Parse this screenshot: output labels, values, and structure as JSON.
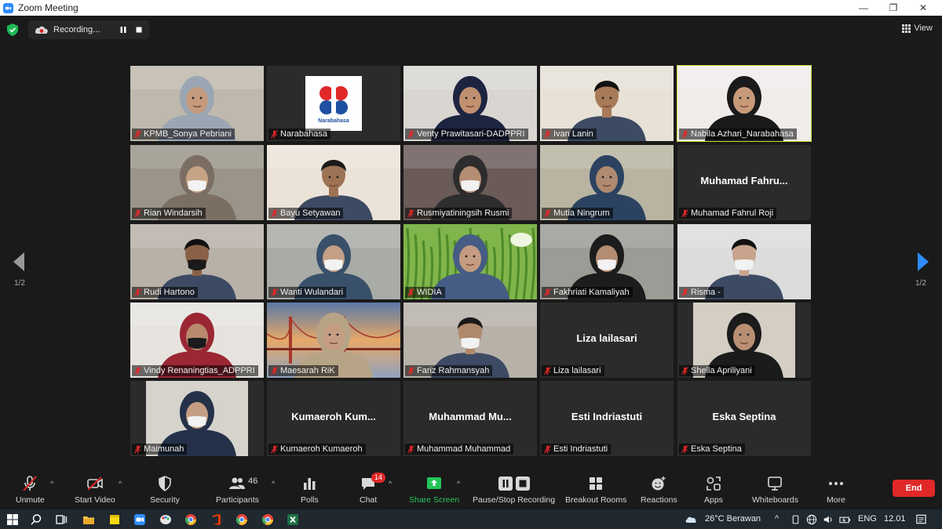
{
  "window": {
    "title": "Zoom Meeting",
    "minimize_icon": "minimize-icon",
    "restore_icon": "restore-icon",
    "close_icon": "close-icon"
  },
  "topbar": {
    "recording_label": "Recording...",
    "view_label": "View"
  },
  "participants": [
    {
      "name": "KPMB_Sonya Pebriani",
      "video": true,
      "bg": "#bfb8ac",
      "skin": "#c59a7c",
      "hijab": "#9aa6b3"
    },
    {
      "name": "Narabahasa",
      "video": false,
      "logo": "Narabahasa"
    },
    {
      "name": "Venty Prawitasari-DADPPRI",
      "video": true,
      "bg": "#d9d6d2",
      "skin": "#c09070",
      "hijab": "#1d2440"
    },
    {
      "name": "Ivan Lanin",
      "video": true,
      "bg": "#e7e1d6",
      "skin": "#a87a58",
      "hair": "#111"
    },
    {
      "name": "Nabila Azhari_Narabahasa",
      "video": true,
      "bg": "#efecea",
      "skin": "#c89a7a",
      "hijab": "#1a1a1a",
      "active": true
    },
    {
      "name": "Rian Windarsih",
      "video": true,
      "bg": "#9a9489",
      "skin": "#c7a385",
      "hijab": "#7b6e63",
      "mask": true
    },
    {
      "name": "Bayu Setyawan",
      "video": true,
      "bg": "#ece3d8",
      "skin": "#9d7255",
      "hair": "#1b1b1b"
    },
    {
      "name": "Rusmiyatiningsih Rusmi",
      "video": true,
      "bg": "#6a5b59",
      "skin": "#b58d72",
      "hijab": "#2d2d2d",
      "mask": true
    },
    {
      "name": "Mutia Ningrum",
      "video": true,
      "bg": "#b9b4a2",
      "skin": "#b08a70",
      "hijab": "#2b4360"
    },
    {
      "name": "Muhamad Fahrul Roji",
      "video": false,
      "display": "Muhamad  Fahru..."
    },
    {
      "name": "Rudi Hartono",
      "video": true,
      "bg": "#b8b1a7",
      "skin": "#8a6148",
      "hair": "#111",
      "mask": true,
      "mask_color": "#1a1a1a"
    },
    {
      "name": "Wanti Wulandari",
      "video": true,
      "bg": "#a9aba6",
      "skin": "#c49f86",
      "hijab": "#38506a",
      "mask": true
    },
    {
      "name": "WIDIA",
      "video": true,
      "bg": "#7fb54a",
      "skin": "#c59c81",
      "hijab": "#455c84"
    },
    {
      "name": "Fakhriati Kamaliyah",
      "video": true,
      "bg": "#9c9c96",
      "skin": "#b38c72",
      "hijab": "#1c1c1c",
      "mask": true
    },
    {
      "name": "Risma -",
      "video": true,
      "bg": "#dcdcdc",
      "skin": "#c9a38c",
      "hair": "#111",
      "mask": true
    },
    {
      "name": "Vindy Renaningtias_ADPPRI",
      "video": true,
      "bg": "#e6e3de",
      "skin": "#b88a6e",
      "hijab": "#9b2734",
      "mask": true,
      "mask_color": "#1b1b1b"
    },
    {
      "name": "Maesarah RiK",
      "video": true,
      "bg": "#d7b58a",
      "skin": "#c59d82",
      "hijab": "#b7a487",
      "scene": "bridge"
    },
    {
      "name": "Fariz Rahmansyah",
      "video": true,
      "bg": "#b7b1a8",
      "skin": "#b0886b",
      "hair": "#1a1a1a",
      "mask": true
    },
    {
      "name": "Liza lailasari",
      "video": false,
      "display": "Liza lailasari"
    },
    {
      "name": "Shella Apriliyani",
      "video": true,
      "bg": "#d5cec4",
      "skin": "#b88f73",
      "hijab": "#1b1b1b",
      "narrow": true
    },
    {
      "name": "Maimunah",
      "video": true,
      "bg": "#d6d3cd",
      "skin": "#c59d82",
      "hijab": "#243149",
      "mask": true,
      "narrow": true
    },
    {
      "name": "Kumaeroh Kumaeroh",
      "video": false,
      "display": "Kumaeroh  Kum..."
    },
    {
      "name": "Muhammad Muhammad",
      "video": false,
      "display": "Muhammad  Mu..."
    },
    {
      "name": "Esti Indriastuti",
      "video": false,
      "display": "Esti Indriastuti"
    },
    {
      "name": "Eska Septina",
      "video": false,
      "display": "Eska Septina"
    }
  ],
  "paging": {
    "left": "1/2",
    "right": "1/2"
  },
  "toolbar": {
    "unmute": "Unmute",
    "start_video": "Start Video",
    "security": "Security",
    "participants": "Participants",
    "participants_count": "46",
    "polls": "Polls",
    "chat": "Chat",
    "chat_badge": "14",
    "share_screen": "Share Screen",
    "recording": "Pause/Stop Recording",
    "breakout": "Breakout Rooms",
    "reactions": "Reactions",
    "apps": "Apps",
    "whiteboards": "Whiteboards",
    "more": "More",
    "end": "End"
  },
  "taskbar": {
    "weather": "26°C  Berawan",
    "lang": "ENG",
    "time": "12.01"
  },
  "colors": {
    "accent_green": "#24c45a",
    "end_red": "#e02828",
    "active_speaker": "#c9dd3a",
    "zoom_blue": "#2d8cff"
  }
}
